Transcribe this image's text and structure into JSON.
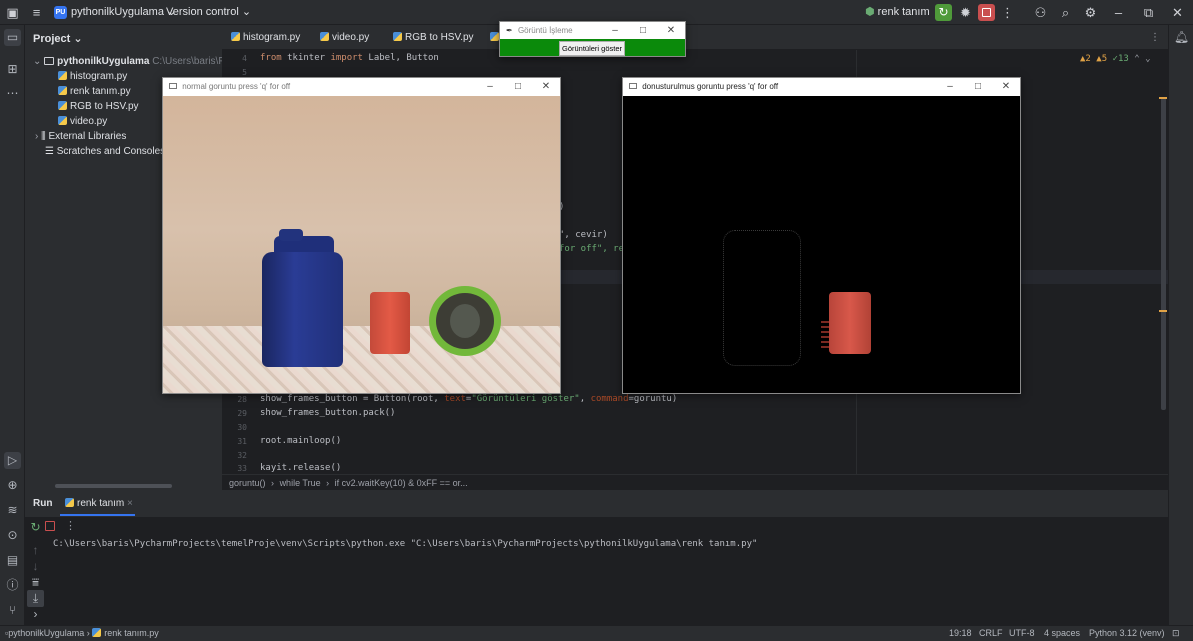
{
  "titlebar": {
    "project_badge": "PU",
    "project_name": "pythonilkUygulama",
    "vcs": "Version control",
    "run_config": "renk tanım"
  },
  "project_panel": {
    "header": "Project",
    "root_name": "pythonilkUygulama",
    "root_path": "C:\\Users\\baris\\PycharmProjects\\pythonilkUygulama",
    "files": [
      "histogram.py",
      "renk tanım.py",
      "RGB to HSV.py",
      "video.py"
    ],
    "external": "External Libraries",
    "scratches": "Scratches and Consoles"
  },
  "tabs": [
    "histogram.py",
    "video.py",
    "RGB to HSV.py"
  ],
  "editor": {
    "inspections": {
      "warnings": "2",
      "weak": "5",
      "ok": "13"
    },
    "lines": [
      {
        "n": "4",
        "text": "from tkinter import Label, Button"
      },
      {
        "n": "5",
        "text": ""
      },
      {
        "n": "28",
        "text": "show_frames_button = Button(root, text=\"Görüntüleri göster\", command=goruntu)"
      },
      {
        "n": "29",
        "text": "show_frames_button.pack()"
      },
      {
        "n": "30",
        "text": ""
      },
      {
        "n": "31",
        "text": "root.mainloop()"
      },
      {
        "n": "32",
        "text": ""
      },
      {
        "n": "33",
        "text": "kayit.release()"
      }
    ],
    "partial_lines": [
      ")",
      "\", cevir)",
      "for off\", rec"
    ],
    "breadcrumb": [
      "goruntu()",
      "while True",
      "if cv2.waitKey(10) & 0xFF == or..."
    ]
  },
  "run": {
    "tab_run": "Run",
    "tab_file": "renk tanım",
    "command": "C:\\Users\\baris\\PycharmProjects\\temelProje\\venv\\Scripts\\python.exe \"C:\\Users\\baris\\PycharmProjects\\pythonilkUygulama\\renk tanım.py\""
  },
  "status": {
    "path_project": "pythonilkUygulama",
    "path_file": "renk tanım.py",
    "position": "19:18",
    "line_sep": "CRLF",
    "encoding": "UTF-8",
    "indent": "4 spaces",
    "interpreter": "Python 3.12 (venv)"
  },
  "windows": {
    "tk": {
      "title": "Görüntü İşleme",
      "button": "Görüntüleri göster"
    },
    "normal": {
      "title": "normal goruntu press 'q' for off"
    },
    "converted": {
      "title": "donusturulmus goruntu press 'q' for off"
    }
  }
}
